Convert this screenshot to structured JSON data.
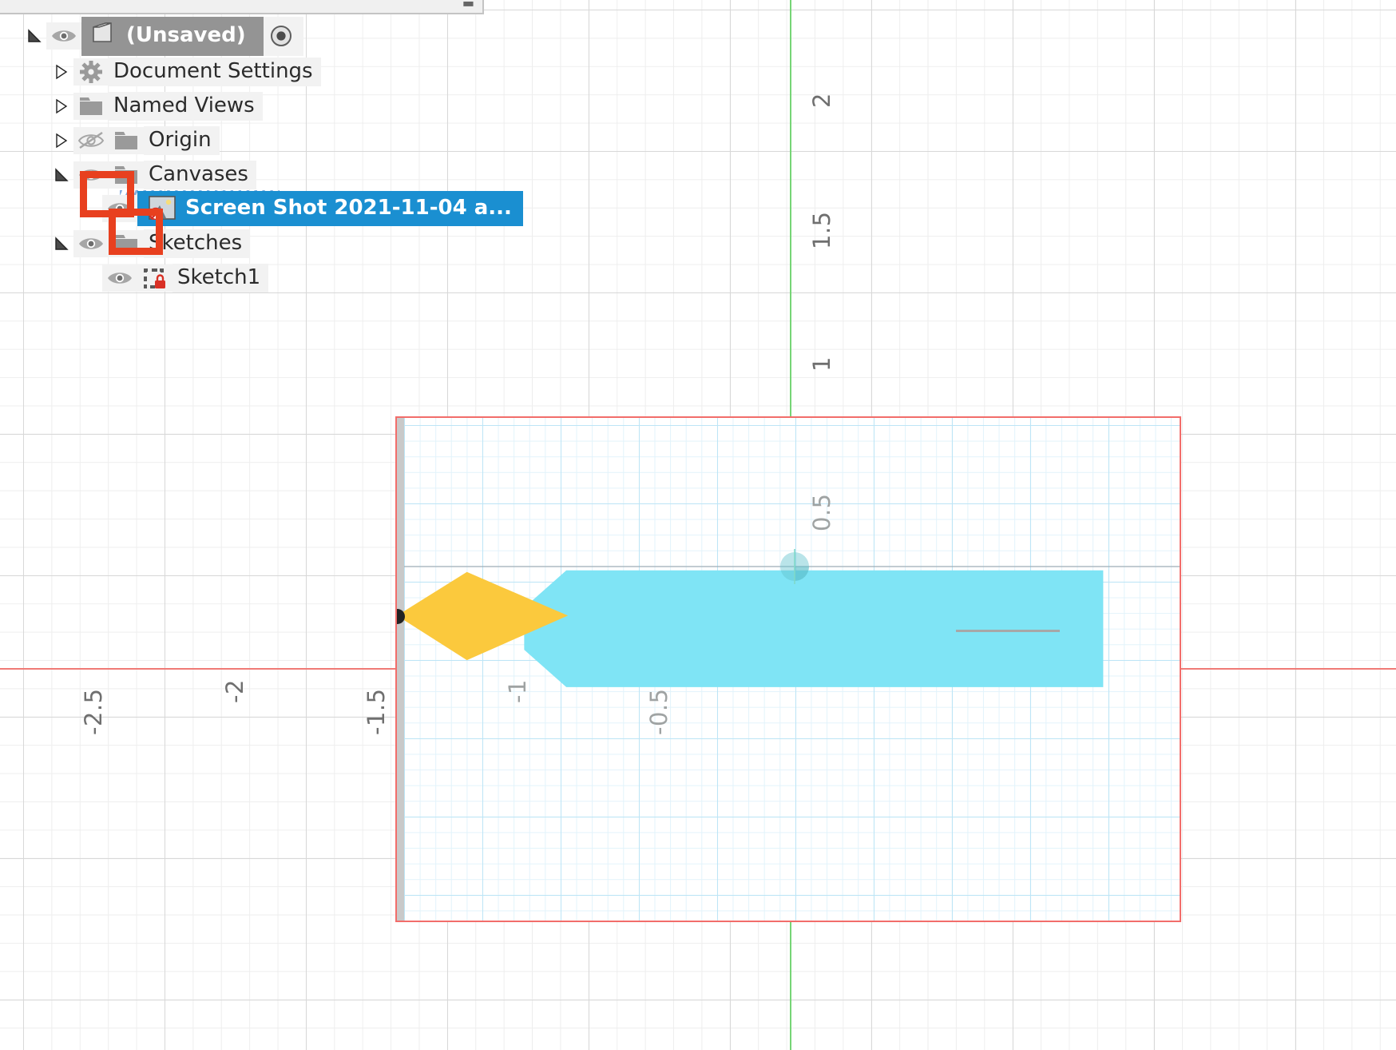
{
  "app": {
    "name": "cad-browser-viewport"
  },
  "browser": {
    "root": {
      "label": "(Unsaved)",
      "icon": "document-cube-icon",
      "eye_icon": "eye-visible-icon",
      "radio_icon": "activate-component-radio-icon",
      "expander": "expander-expanded-icon"
    },
    "items": [
      {
        "label": "Document Settings",
        "icon": "gear-icon",
        "expander": "expander-collapsed-icon",
        "eye": null,
        "indent": 1
      },
      {
        "label": "Named Views",
        "icon": "folder-icon",
        "expander": "expander-collapsed-icon",
        "eye": null,
        "indent": 1
      },
      {
        "label": "Origin",
        "icon": "folder-icon",
        "expander": "expander-collapsed-icon",
        "eye": "eye-hidden-icon",
        "indent": 1
      },
      {
        "label": "Canvases",
        "icon": "folder-icon",
        "expander": "expander-expanded-icon",
        "eye": "eye-visible-icon",
        "indent": 1
      },
      {
        "label": "Screen Shot 2021-11-04 a...",
        "icon": "canvas-image-suppressed-icon",
        "expander": null,
        "eye": "eye-visible-icon",
        "indent": 2,
        "selected": true
      },
      {
        "label": "Sketches",
        "icon": "folder-icon",
        "expander": "expander-expanded-icon",
        "eye": "eye-visible-icon",
        "indent": 1
      },
      {
        "label": "Sketch1",
        "icon": "sketch-locked-icon",
        "expander": null,
        "eye": "eye-visible-icon",
        "indent": 2
      }
    ]
  },
  "annotations": {
    "highlight_color": "#e8401f",
    "highlights": [
      {
        "name": "canvases-visibility-highlight"
      },
      {
        "name": "canvas-item-visibility-highlight"
      }
    ]
  },
  "viewport": {
    "x_axis_color": "#f07a76",
    "y_axis_color": "#76d576",
    "canvas_border_color": "#f26d6a",
    "x_ticks": [
      "-2.5",
      "-2",
      "-1.5",
      "-1",
      "-0.5"
    ],
    "y_ticks": [
      "2",
      "1.5",
      "1",
      "0.5"
    ],
    "canvas_ticks": [
      "0.5",
      "-0.5",
      "-1"
    ],
    "shapes": {
      "body_color": "#7fe4f5",
      "nose_color": "#fbc93d",
      "origin_marker_color": "#222222",
      "body_name": "cyan-airfoil-body",
      "nose_name": "yellow-nose-diamond"
    }
  }
}
